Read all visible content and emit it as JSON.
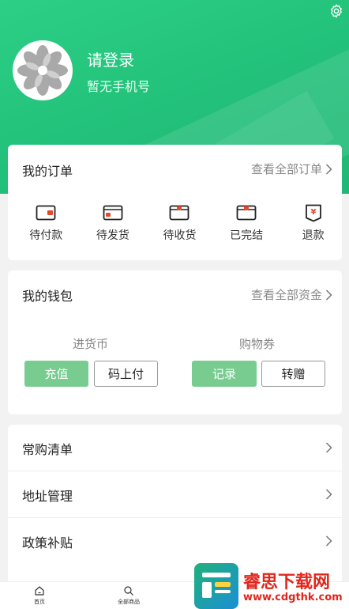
{
  "header": {
    "title": "请登录",
    "subtitle": "暂无手机号",
    "accent": "#22c07a"
  },
  "orders": {
    "title": "我的订单",
    "link": "查看全部订单",
    "items": [
      {
        "label": "待付款",
        "icon": "wallet-icon"
      },
      {
        "label": "待发货",
        "icon": "truck-box-icon"
      },
      {
        "label": "待收货",
        "icon": "box-icon"
      },
      {
        "label": "已完结",
        "icon": "done-box-icon"
      },
      {
        "label": "退款",
        "icon": "refund-icon"
      }
    ]
  },
  "wallet": {
    "title": "我的钱包",
    "link": "查看全部资金",
    "coin_label": "进货币",
    "voucher_label": "购物券",
    "recharge": "充值",
    "pay_code": "码上付",
    "record": "记录",
    "gift": "转赠"
  },
  "menu": {
    "items": [
      {
        "label": "常购清单"
      },
      {
        "label": "地址管理"
      },
      {
        "label": "政策补贴"
      }
    ]
  },
  "tabbar": {
    "home": "首页",
    "all": "全部商品"
  },
  "watermark": {
    "title": "睿思下载网",
    "url": "www.cdgthk.com"
  }
}
